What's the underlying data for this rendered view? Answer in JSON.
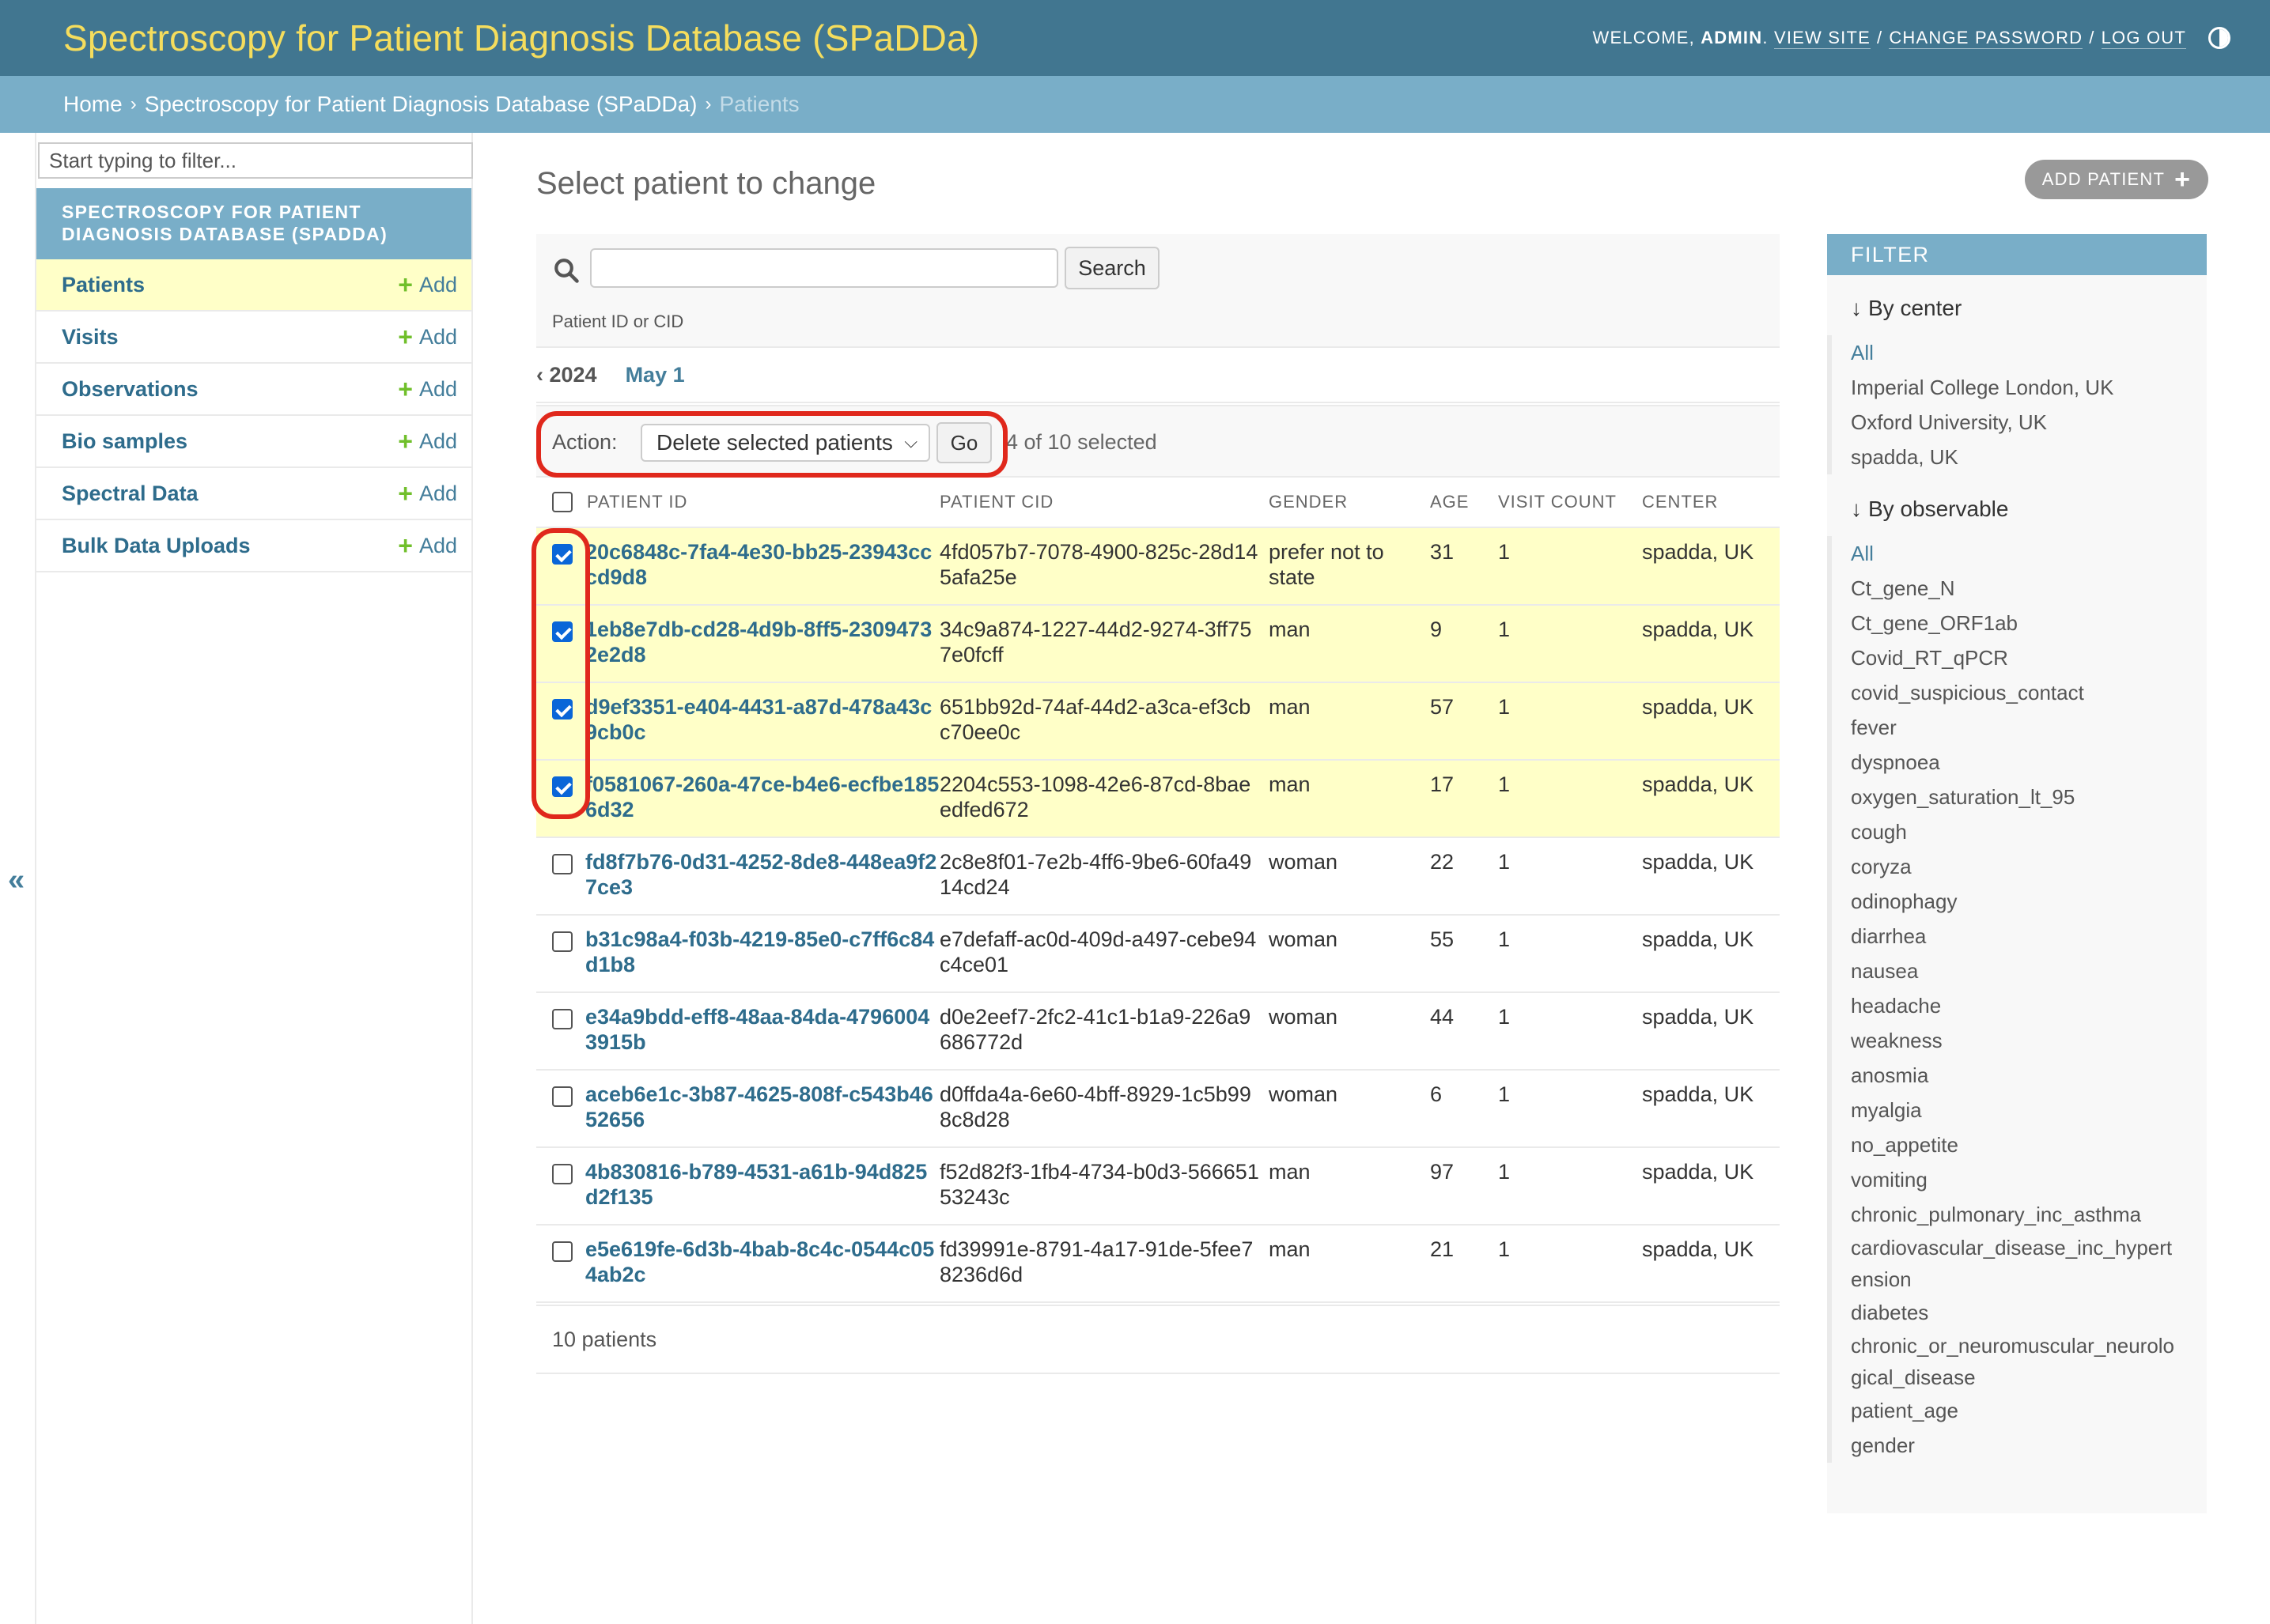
{
  "header": {
    "site_title": "Spectroscopy for Patient Diagnosis Database (SPaDDa)",
    "welcome": "Welcome,",
    "username": "admin",
    "view_site": "View site",
    "change_password": "Change password",
    "log_out": "Log out"
  },
  "breadcrumbs": {
    "home": "Home",
    "app": "Spectroscopy for Patient Diagnosis Database (SPaDDa)",
    "current": "Patients",
    "separator": "›"
  },
  "sidebar": {
    "filter_placeholder": "Start typing to filter...",
    "app_caption": "Spectroscopy for Patient Diagnosis Database (SPaDDa)",
    "add_label": "Add",
    "models": [
      {
        "name": "Patients"
      },
      {
        "name": "Visits"
      },
      {
        "name": "Observations"
      },
      {
        "name": "Bio samples"
      },
      {
        "name": "Spectral Data"
      },
      {
        "name": "Bulk Data Uploads"
      }
    ],
    "toggle": "«"
  },
  "main": {
    "title": "Select patient to change",
    "add_button": "Add patient",
    "search_button": "Search",
    "search_help": "Patient ID or CID",
    "date_back": "‹ 2024",
    "date_month": "May 1",
    "action_label": "Action:",
    "action_selected": "Delete selected patients",
    "go_button": "Go",
    "selection_counter": "4 of 10 selected",
    "paginator": "10 patients"
  },
  "table": {
    "headers": {
      "patient_id": "Patient ID",
      "patient_cid": "Patient CID",
      "gender": "Gender",
      "age": "Age",
      "visit_count": "Visit count",
      "center": "Center"
    },
    "rows": [
      {
        "id": "20c6848c-7fa4-4e30-bb25-23943cccd9d8",
        "cid": "4fd057b7-7078-4900-825c-28d145afa25e",
        "gender": "prefer not to state",
        "age": "31",
        "visits": "1",
        "center": "spadda, UK"
      },
      {
        "id": "1eb8e7db-cd28-4d9b-8ff5-23094732e2d8",
        "cid": "34c9a874-1227-44d2-9274-3ff757e0fcff",
        "gender": "man",
        "age": "9",
        "visits": "1",
        "center": "spadda, UK"
      },
      {
        "id": "d9ef3351-e404-4431-a87d-478a43c9cb0c",
        "cid": "651bb92d-74af-44d2-a3ca-ef3cbc70ee0c",
        "gender": "man",
        "age": "57",
        "visits": "1",
        "center": "spadda, UK"
      },
      {
        "id": "f0581067-260a-47ce-b4e6-ecfbe1856d32",
        "cid": "2204c553-1098-42e6-87cd-8baeedfed672",
        "gender": "man",
        "age": "17",
        "visits": "1",
        "center": "spadda, UK"
      },
      {
        "id": "fd8f7b76-0d31-4252-8de8-448ea9f27ce3",
        "cid": "2c8e8f01-7e2b-4ff6-9be6-60fa4914cd24",
        "gender": "woman",
        "age": "22",
        "visits": "1",
        "center": "spadda, UK"
      },
      {
        "id": "b31c98a4-f03b-4219-85e0-c7ff6c84d1b8",
        "cid": "e7defaff-ac0d-409d-a497-cebe94c4ce01",
        "gender": "woman",
        "age": "55",
        "visits": "1",
        "center": "spadda, UK"
      },
      {
        "id": "e34a9bdd-eff8-48aa-84da-47960043915b",
        "cid": "d0e2eef7-2fc2-41c1-b1a9-226a9686772d",
        "gender": "woman",
        "age": "44",
        "visits": "1",
        "center": "spadda, UK"
      },
      {
        "id": "aceb6e1c-3b87-4625-808f-c543b4652656",
        "cid": "d0ffda4a-6e60-4bff-8929-1c5b998c8d28",
        "gender": "woman",
        "age": "6",
        "visits": "1",
        "center": "spadda, UK"
      },
      {
        "id": "4b830816-b789-4531-a61b-94d825d2f135",
        "cid": "f52d82f3-1fb4-4734-b0d3-56665153243c",
        "gender": "man",
        "age": "97",
        "visits": "1",
        "center": "spadda, UK"
      },
      {
        "id": "e5e619fe-6d3b-4bab-8c4c-0544c054ab2c",
        "cid": "fd39991e-8791-4a17-91de-5fee78236d6d",
        "gender": "man",
        "age": "21",
        "visits": "1",
        "center": "spadda, UK"
      }
    ],
    "selected_count": 4
  },
  "filter": {
    "title": "Filter",
    "by_center": "By center",
    "centers": [
      "All",
      "Imperial College London, UK",
      "Oxford University, UK",
      "spadda, UK"
    ],
    "by_observable": "By observable",
    "observables": [
      "All",
      "Ct_gene_N",
      "Ct_gene_ORF1ab",
      "Covid_RT_qPCR",
      "covid_suspicious_contact",
      "fever",
      "dyspnoea",
      "oxygen_saturation_lt_95",
      "cough",
      "coryza",
      "odinophagy",
      "diarrhea",
      "nausea",
      "headache",
      "weakness",
      "anosmia",
      "myalgia",
      "no_appetite",
      "vomiting",
      "chronic_pulmonary_inc_asthma",
      "cardiovascular_disease_inc_hypertension",
      "diabetes",
      "chronic_or_neuromuscular_neurological_disease",
      "patient_age",
      "gender"
    ]
  },
  "colors": {
    "header_bg": "#417690",
    "branding": "#f5dd5d",
    "breadcrumb_bg": "#79aec8",
    "selected_row": "#ffffc8",
    "link": "#447e9b",
    "highlight": "#e0281c"
  }
}
